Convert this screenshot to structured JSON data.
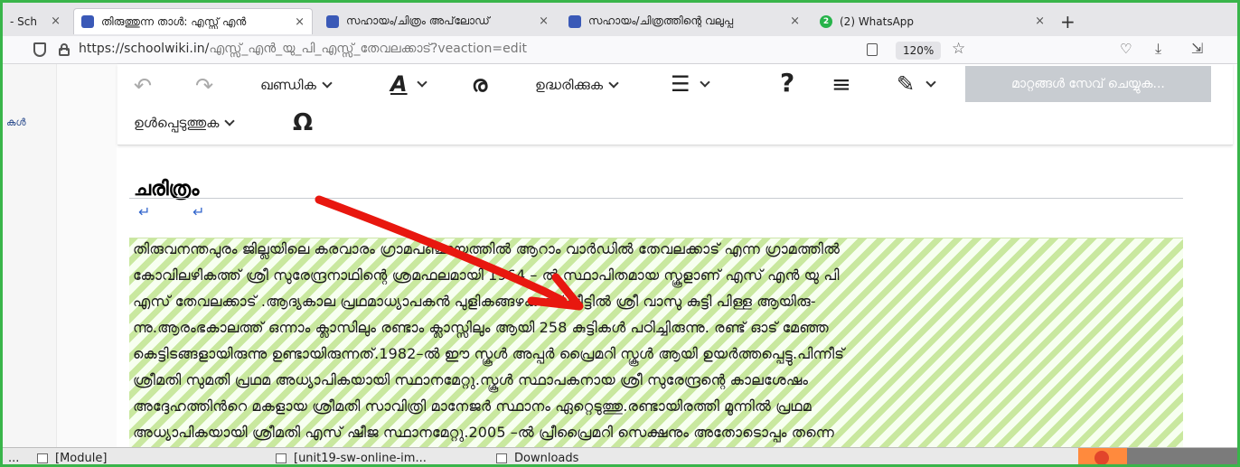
{
  "browser": {
    "tabs": [
      {
        "label": "- Sch",
        "active": false
      },
      {
        "label": "തിരുത്തുന്ന താൾ: എസ്സ് എൻ",
        "active": true
      },
      {
        "label": "സഹായം/ചിത്രം അപ്‌ലോഡ്",
        "active": false
      },
      {
        "label": "സഹായം/ചിത്രത്തിന്റെ വലുപ്പ",
        "active": false
      },
      {
        "label": "(2) WhatsApp",
        "active": false,
        "badge": "2"
      }
    ],
    "close_glyph": "×",
    "new_tab_glyph": "+",
    "url_main": "https://schoolwiki.in/",
    "url_path": "എസ്സ്_എൻ_യു_പി_എസ്സ്_തേവലക്കാട്?veaction=edit",
    "zoom": "120%"
  },
  "sidebar": {
    "link_label": "കൾ"
  },
  "editor": {
    "toolbar": {
      "paragraph_label": "ഖണ്ഡിക",
      "cite_label": "ഉദ്ധരിക്കുക",
      "insert_label": "ഉൾപ്പെടുത്തുക",
      "help_glyph": "?",
      "link_glyph": "ര",
      "text_style_glyph": "A",
      "special_char_glyph": "Ω",
      "save_label": "മാറ്റങ്ങൾ സേവ് ചെയ്യുക..."
    },
    "heading": "ചരിത്രം",
    "para_marks": [
      "↵",
      "↵"
    ],
    "content_lines": [
      "തിരുവനന്തപുരം ജില്ലയിലെ കരവാരം ഗ്രാമപഞ്ചായത്തിൽ ആറാം വാർഡിൽ തേവലക്കാട് എന്ന ഗ്രാമത്തിൽ",
      "കോവിലഴികത്ത് ശ്രീ സുരേന്ദ്രനാഥിന്റെ ശ്രമഫലമായി 1964 – ൽ സ്ഥാപിതമായ സ്കൂളാണ് എസ് എൻ യു പി",
      "എസ് തേവലക്കാട് .ആദ്യകാല പ്രഥമാധ്യാപകൻ പുളികങ്ങഴകത്ത് വീട്ടിൽ ശ്രീ വാസു കുട്ടി പിള്ള ആയിരു-",
      "ന്നു.ആരംഭകാലത്ത് ഒന്നാം ക്ലാസിലും രണ്ടാം ക്ലാസ്സിലും ആയി 258 കുട്ടികൾ പഠിച്ചിരുന്നു. രണ്ട് ഓട് മേഞ്ഞ",
      "കെട്ടിടങ്ങളായിരുന്നു ഉണ്ടായിരുന്നത്.1982–ൽ ഈ സ്കൂൾ അപ്പർ പ്രൈമറി സ്കൂൾ ആയി ഉയർത്തപ്പെട്ടു.പിന്നീട്",
      "ശ്രീമതി സുമതി പ്രഥമ അധ്യാപികയായി സ്ഥാനമേറ്റു.സ്കൂൾ സ്ഥാപകനായ ശ്രീ സുരേന്ദ്രന്റെ കാലശേഷം",
      "അദ്ദേഹത്തിൻറെ മകളായ ശ്രീമതി സാവിത്രി മാനേജർ സ്ഥാനം ഏറ്റെടുത്തു.രണ്ടായിരത്തി മൂന്നിൽ പ്രഥമ",
      "അധ്യാപികയായി ശ്രീമതി എസ് ഷീജ സ്ഥാനമേറ്റു.2005 –ൽ പ്രീപ്രൈമറി സെക്ഷനും അതോടൊപ്പം തന്നെ"
    ]
  },
  "annotation": {
    "arrow_color": "#e8170f"
  },
  "taskbar": {
    "start_label": "...",
    "items": [
      "[Module]",
      "[unit19-sw-online-im...",
      "Downloads"
    ]
  },
  "colors": {
    "accent_border": "#39b54a",
    "link": "#3366cc",
    "save_disabled": "#c8ccd1"
  }
}
